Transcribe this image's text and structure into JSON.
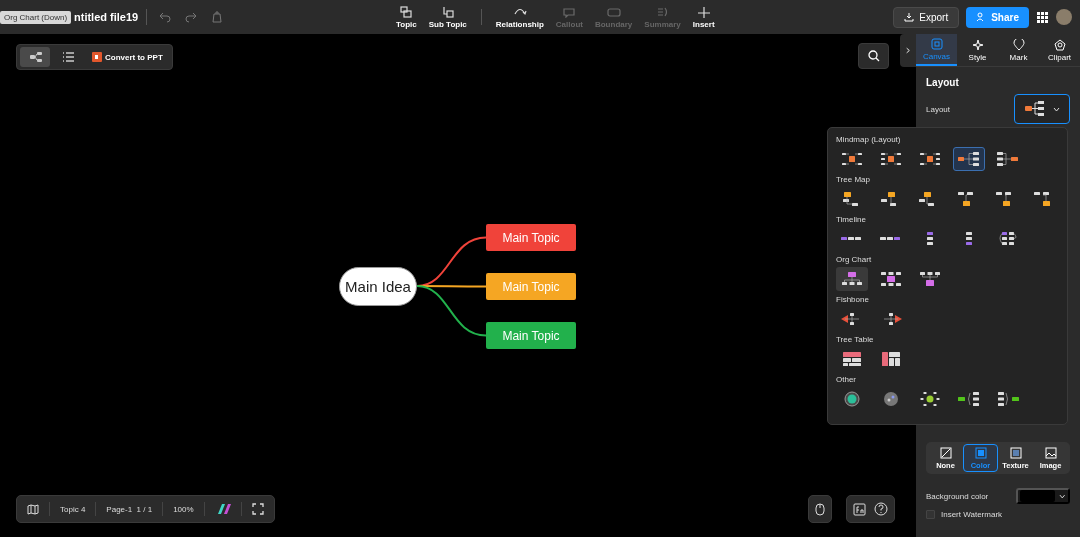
{
  "top_bar": {
    "tooltip": "Org Chart (Down)",
    "title": "ntitled file19",
    "tools": [
      {
        "label": "Topic",
        "kind": "topic",
        "disabled": false
      },
      {
        "label": "Sub Topic",
        "kind": "subtopic",
        "disabled": false
      },
      {
        "label": "Relationship",
        "kind": "relationship",
        "disabled": false
      },
      {
        "label": "Callout",
        "kind": "callout",
        "disabled": true
      },
      {
        "label": "Boundary",
        "kind": "boundary",
        "disabled": true
      },
      {
        "label": "Summary",
        "kind": "summary",
        "disabled": true
      },
      {
        "label": "Insert",
        "kind": "insert",
        "disabled": false
      }
    ],
    "export": "Export",
    "share": "Share"
  },
  "canvas_toolbar": {
    "views": [
      {
        "kind": "map",
        "selected": true
      },
      {
        "kind": "outline",
        "selected": false
      }
    ],
    "convert": "Convert to PPT"
  },
  "mind_map": {
    "root": "Main Idea",
    "topics": [
      {
        "label": "Main Topic",
        "color": "#f0433a"
      },
      {
        "label": "Main Topic",
        "color": "#f5a623"
      },
      {
        "label": "Main Topic",
        "color": "#22b14c"
      }
    ]
  },
  "panel": {
    "tabs": [
      {
        "label": "Canvas",
        "kind": "canvas",
        "selected": true
      },
      {
        "label": "Style",
        "kind": "style",
        "selected": false
      },
      {
        "label": "Mark",
        "kind": "mark",
        "selected": false
      },
      {
        "label": "Clipart",
        "kind": "clipart",
        "selected": false
      }
    ],
    "section": "Layout",
    "layout_label": "Layout",
    "background_options": [
      {
        "label": "None",
        "kind": "none",
        "selected": false
      },
      {
        "label": "Color",
        "kind": "color",
        "selected": true
      },
      {
        "label": "Texture",
        "kind": "texture",
        "selected": false
      },
      {
        "label": "Image",
        "kind": "image",
        "selected": false
      }
    ],
    "background_color_label": "Background color",
    "watermark": {
      "label": "Insert Watermark",
      "checked": false
    }
  },
  "layout_menu": {
    "groups": [
      {
        "title": "Mindmap (Layout)",
        "kind": "mindmap",
        "options": [
          {
            "selected": false,
            "hovered": false
          },
          {
            "selected": false,
            "hovered": false
          },
          {
            "selected": false,
            "hovered": false
          },
          {
            "selected": true,
            "hovered": false
          },
          {
            "selected": false,
            "hovered": false
          }
        ]
      },
      {
        "title": "Tree Map",
        "kind": "tree",
        "options": [
          {
            "selected": false,
            "hovered": false
          },
          {
            "selected": false,
            "hovered": false
          },
          {
            "selected": false,
            "hovered": false
          },
          {
            "selected": false,
            "hovered": false
          },
          {
            "selected": false,
            "hovered": false
          },
          {
            "selected": false,
            "hovered": false
          }
        ]
      },
      {
        "title": "Timeline",
        "kind": "timeline",
        "options": [
          {
            "selected": false,
            "hovered": false
          },
          {
            "selected": false,
            "hovered": false
          },
          {
            "selected": false,
            "hovered": false
          },
          {
            "selected": false,
            "hovered": false
          },
          {
            "selected": false,
            "hovered": false
          }
        ]
      },
      {
        "title": "Org Chart",
        "kind": "org",
        "options": [
          {
            "selected": false,
            "hovered": true
          },
          {
            "selected": false,
            "hovered": false
          },
          {
            "selected": false,
            "hovered": false
          }
        ]
      },
      {
        "title": "Fishbone",
        "kind": "fishbone",
        "options": [
          {
            "selected": false,
            "hovered": false
          },
          {
            "selected": false,
            "hovered": false
          }
        ]
      },
      {
        "title": "Tree Table",
        "kind": "table",
        "options": [
          {
            "selected": false,
            "hovered": false
          },
          {
            "selected": false,
            "hovered": false
          }
        ]
      },
      {
        "title": "Other",
        "kind": "other",
        "options": [
          {
            "selected": false,
            "hovered": false
          },
          {
            "selected": false,
            "hovered": false
          },
          {
            "selected": false,
            "hovered": false
          },
          {
            "selected": false,
            "hovered": false
          },
          {
            "selected": false,
            "hovered": false
          }
        ]
      }
    ]
  },
  "status_bar": {
    "topic": "Topic 4",
    "page": "Page-1  1 / 1",
    "zoom": "100%"
  }
}
